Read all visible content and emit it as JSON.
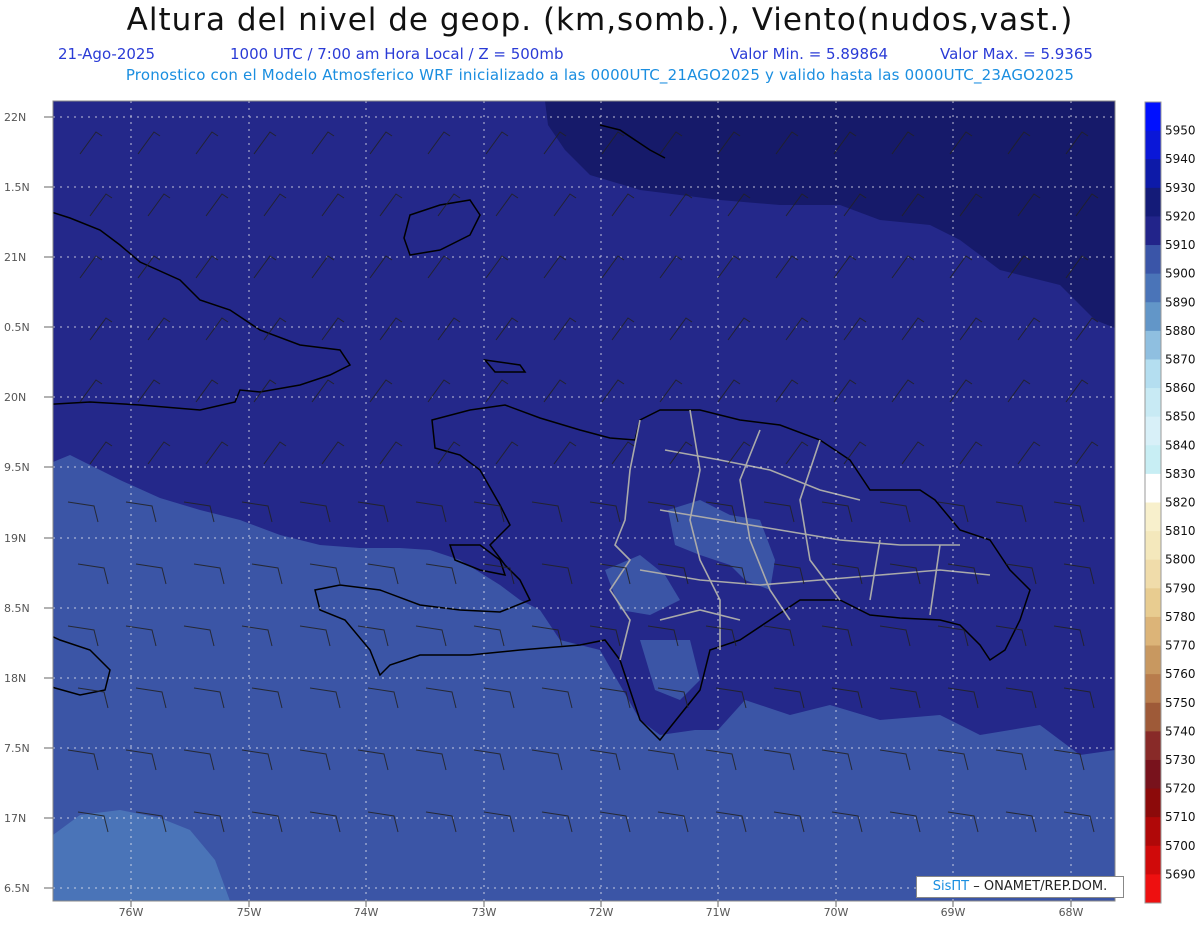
{
  "header": {
    "title": "Altura del nivel de geop. (km,somb.), Viento(nudos,vast.)",
    "date": "21-Ago-2025",
    "time": "1000 UTC / 7:00 am Hora Local / Z = 500mb",
    "min": "Valor Min. = 5.89864",
    "max": "Valor Max. = 5.9365",
    "forecast": "Pronostico con el Modelo Atmosferico WRF inicializado a las 0000UTC_21AGO2025 y valido hasta las  0000UTC_23AGO2025"
  },
  "axes": {
    "lat_labels": [
      "22N",
      "1.5N",
      "21N",
      "0.5N",
      "20N",
      "9.5N",
      "19N",
      "8.5N",
      "18N",
      "7.5N",
      "17N",
      "6.5N"
    ],
    "lon_labels": [
      "76W",
      "75W",
      "74W",
      "73W",
      "72W",
      "71W",
      "70W",
      "69W",
      "68W"
    ]
  },
  "colorbar": {
    "labels": [
      "5950",
      "5940",
      "5930",
      "5920",
      "5910",
      "5900",
      "5890",
      "5880",
      "5870",
      "5860",
      "5850",
      "5840",
      "5830",
      "5820",
      "5810",
      "5800",
      "5790",
      "5780",
      "5770",
      "5760",
      "5750",
      "5740",
      "5730",
      "5720",
      "5710",
      "5700",
      "5690"
    ],
    "colors": [
      "#0010ff",
      "#0a17d8",
      "#0d1aa8",
      "#141b78",
      "#22248a",
      "#3a55a8",
      "#4a74b8",
      "#6296c8",
      "#8fbfe0",
      "#b4def0",
      "#c8eaf4",
      "#d8f0f8",
      "#c8eef4",
      "#ffffff",
      "#f8f0cc",
      "#f4e8bc",
      "#f0dcaa",
      "#e8cc90",
      "#dcb478",
      "#c89860",
      "#b87c4c",
      "#9e5a38",
      "#882a28",
      "#78121c",
      "#8c0a0a",
      "#b00808",
      "#d00a0a",
      "#ee1010"
    ]
  },
  "legend": {
    "fill_colors": {
      "outer": "#3b55a6",
      "mid": "#24288a",
      "high": "#161a6a",
      "low": "#4a74b8"
    }
  },
  "credit": {
    "brand": "SisΠΤ",
    "org": "– ONAMET/REP.DOM."
  }
}
